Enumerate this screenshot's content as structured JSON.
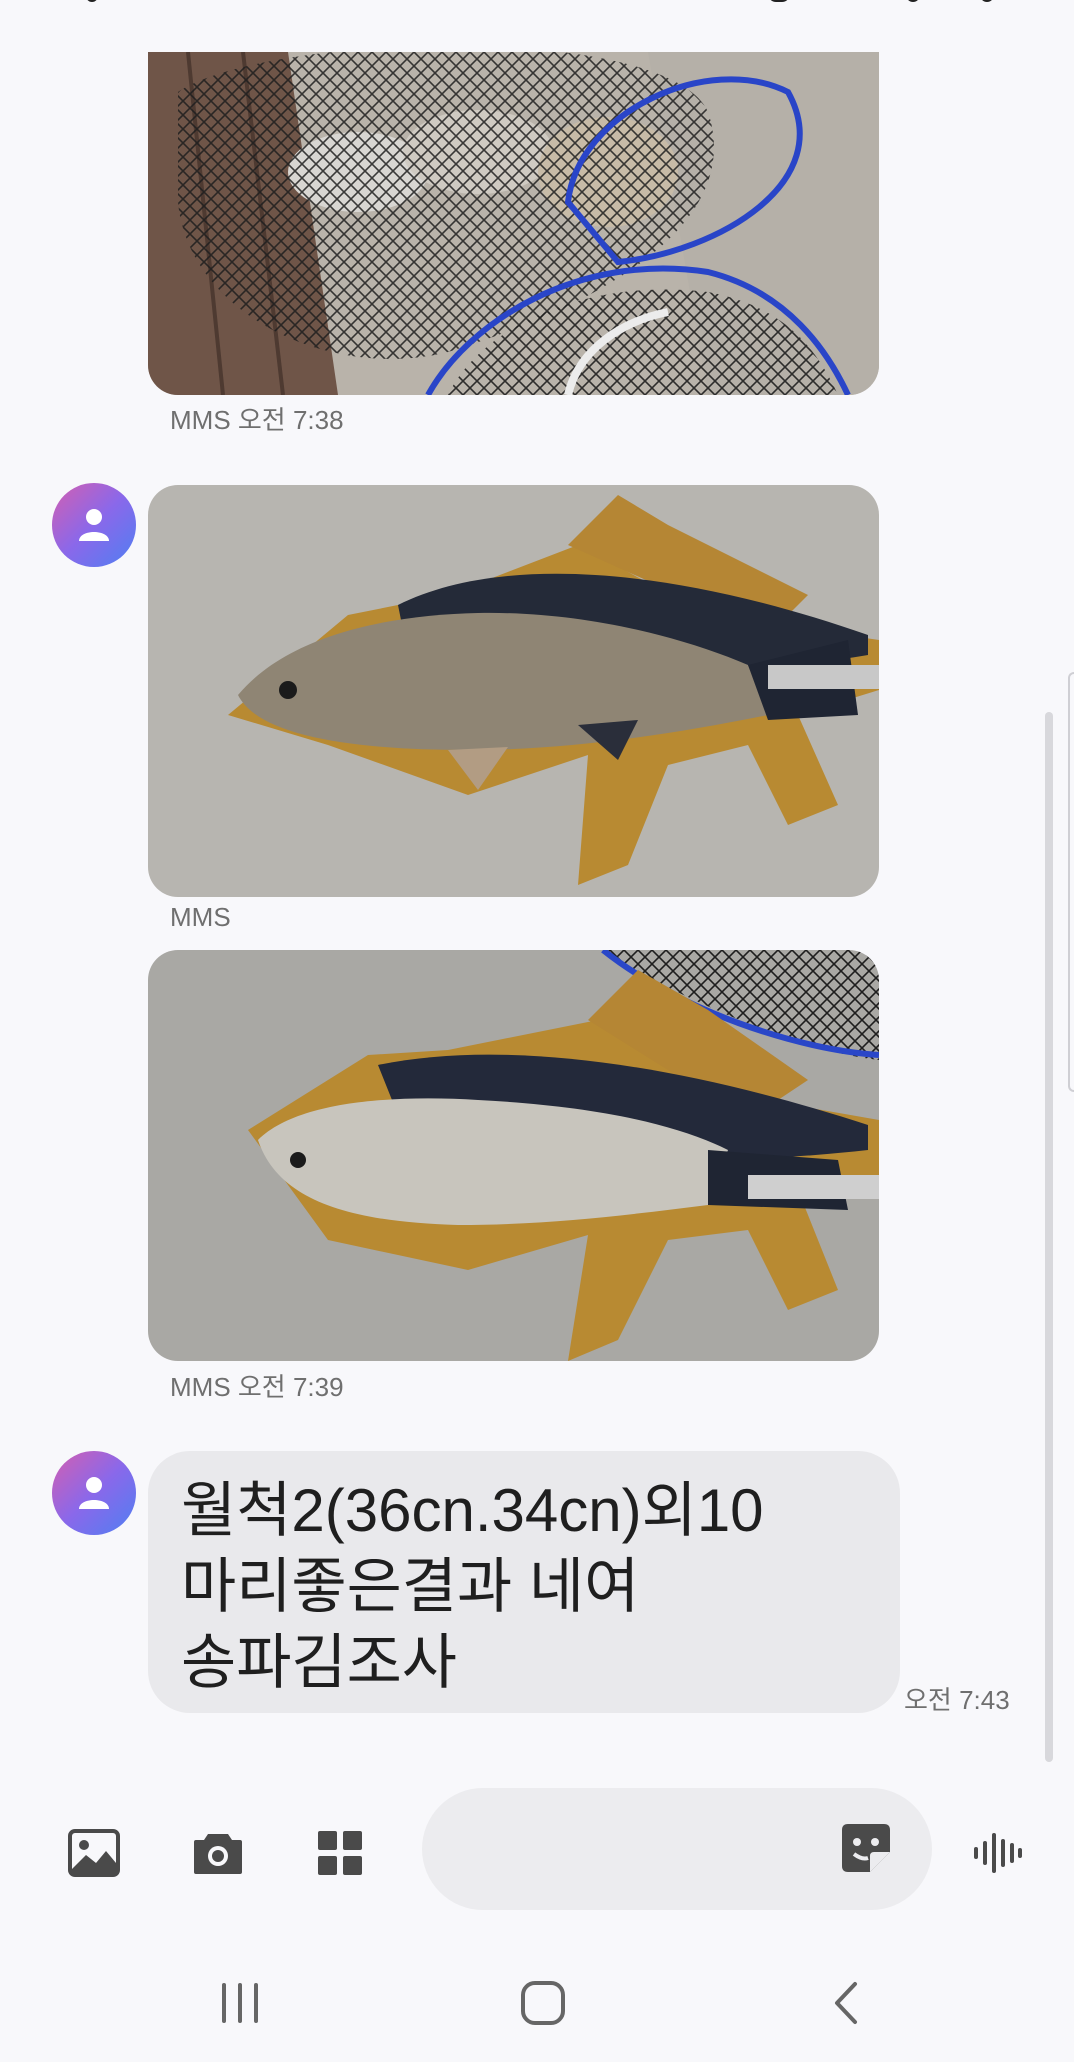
{
  "messages": [
    {
      "type": "mms-image",
      "image": "fishing-nets-with-fish",
      "meta": "MMS 오전 7:38"
    },
    {
      "type": "mms-image",
      "image": "crucian-carp-on-measuring-board-1",
      "meta": "MMS"
    },
    {
      "type": "mms-image",
      "image": "crucian-carp-on-measuring-board-2",
      "meta": "MMS 오전 7:39"
    },
    {
      "type": "text",
      "text": "월척2(36cn.34cn)외10\n마리좋은결과 네여\n송파김조사",
      "time": "오전 7:43"
    }
  ],
  "composer": {
    "placeholder": "",
    "icons": [
      "gallery-icon",
      "camera-icon",
      "apps-icon",
      "sticker-icon",
      "voice-icon"
    ]
  },
  "navbar": {
    "icons": [
      "recent-apps-icon",
      "home-icon",
      "back-icon"
    ]
  },
  "colors": {
    "background": "#f8f8fb",
    "bubble": "#e9e9ec",
    "avatar_gradient": [
      "#d45fb0",
      "#8a68ea",
      "#4f7ff2"
    ]
  }
}
